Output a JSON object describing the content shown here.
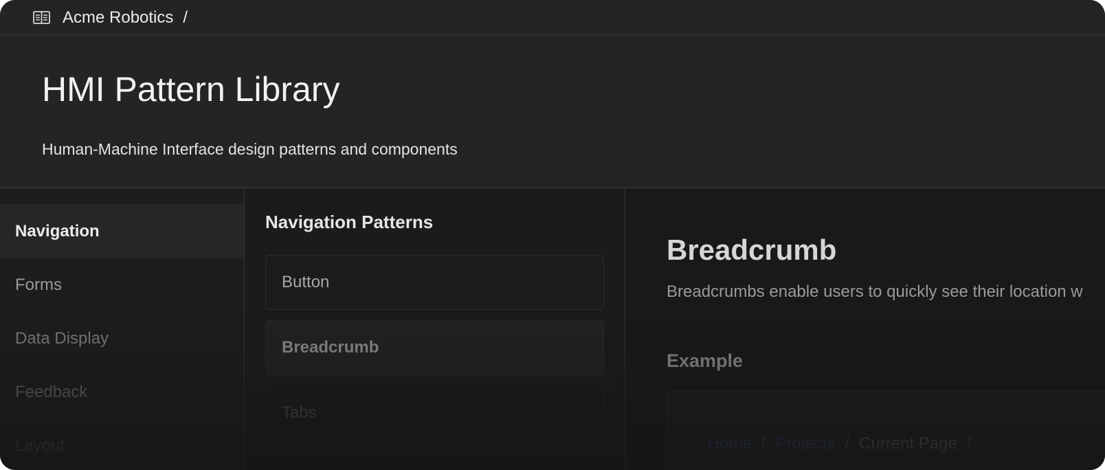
{
  "topbar": {
    "brand_icon": "book-open-icon",
    "org_name": "Acme Robotics",
    "separator": "/"
  },
  "header": {
    "title": "HMI Pattern Library",
    "subtitle": "Human-Machine Interface design patterns and components"
  },
  "sidebar": {
    "items": [
      {
        "label": "Navigation",
        "active": true
      },
      {
        "label": "Forms",
        "active": false
      },
      {
        "label": "Data Display",
        "active": false
      },
      {
        "label": "Feedback",
        "active": false
      },
      {
        "label": "Layout",
        "active": false
      }
    ]
  },
  "patterns": {
    "title": "Navigation Patterns",
    "items": [
      {
        "label": "Button",
        "selected": false
      },
      {
        "label": "Breadcrumb",
        "selected": true
      },
      {
        "label": "Tabs",
        "selected": false
      }
    ]
  },
  "detail": {
    "title": "Breadcrumb",
    "description": "Breadcrumbs enable users to quickly see their location w",
    "example_label": "Example",
    "example_breadcrumb": {
      "home": "Home",
      "projects": "Projects",
      "current": "Current Page",
      "separator": "/"
    }
  },
  "colors": {
    "background": "#1b1b1b",
    "header_bg": "#242424",
    "active_item_bg": "#262626",
    "link": "#2a3350"
  }
}
